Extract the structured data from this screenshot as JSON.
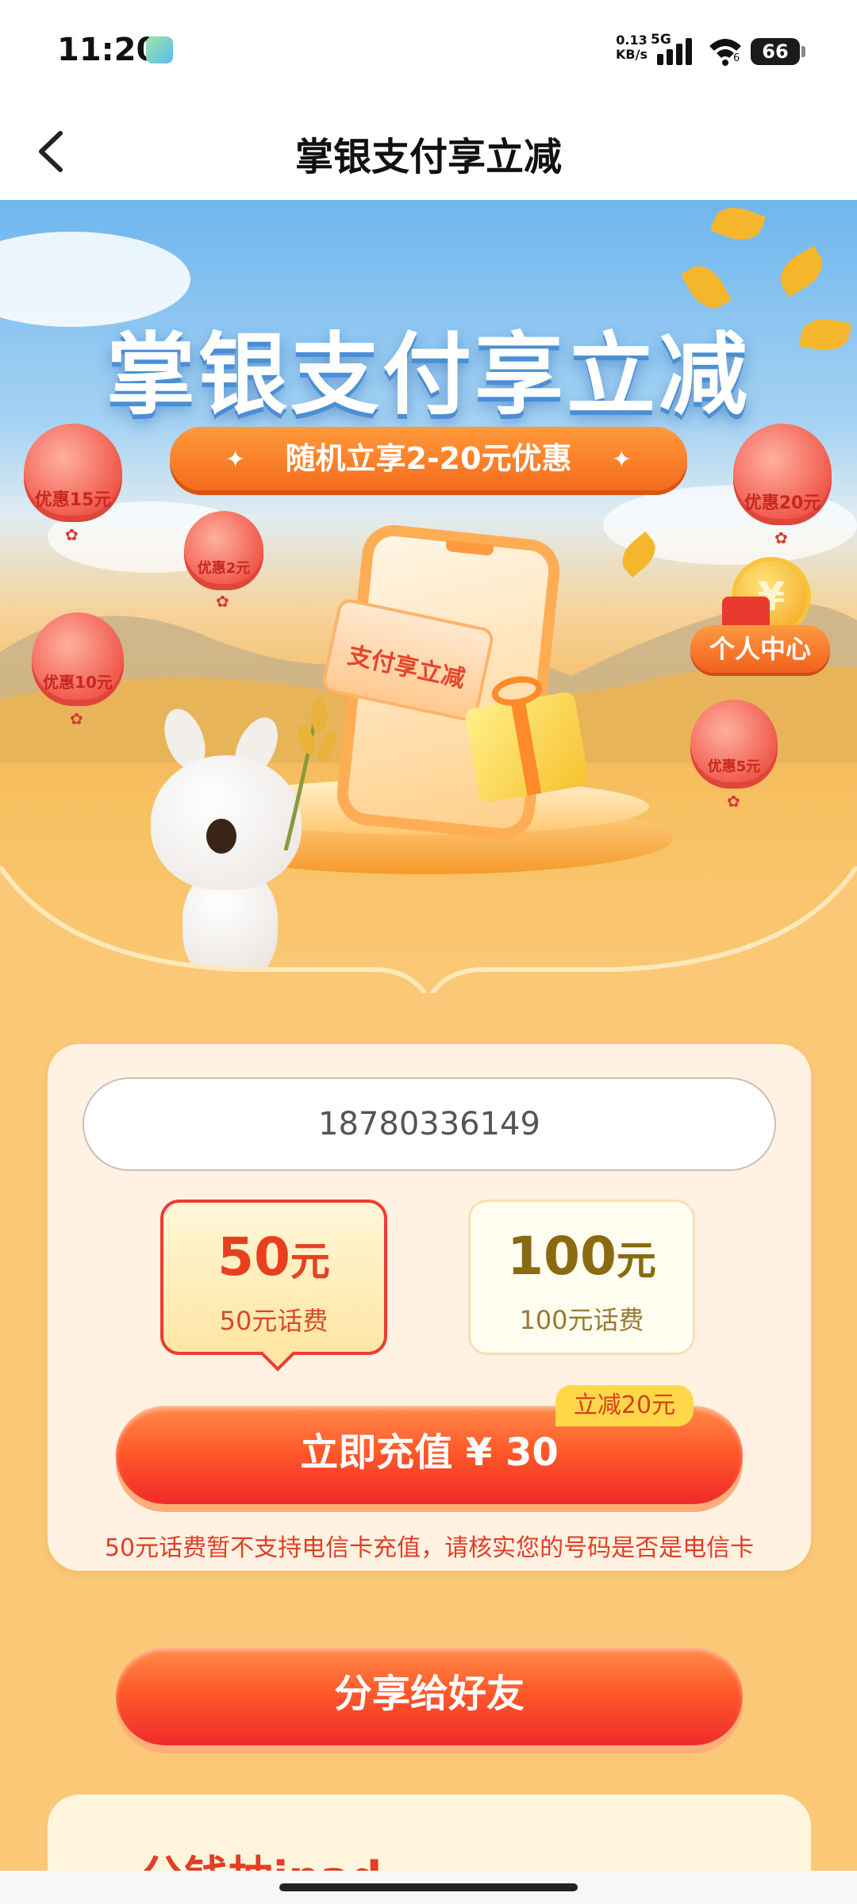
{
  "status_bar": {
    "time": "11:20",
    "net_speed_value": "0.13",
    "net_speed_unit": "KB/s",
    "net_type": "5G",
    "wifi_label": "6",
    "battery_level": "66"
  },
  "nav": {
    "title": "掌银支付享立减",
    "back_icon": "chevron-left-icon"
  },
  "banner": {
    "title": "掌银支付享立减",
    "subtitle": "随机立享2-20元优惠",
    "ticket_text": "支付享立减",
    "personal_center": "个人中心",
    "balloons": [
      {
        "label": "优惠15元"
      },
      {
        "label": "优惠2元"
      },
      {
        "label": "优惠10元"
      },
      {
        "label": "优惠20元"
      },
      {
        "label": "优惠5元"
      }
    ]
  },
  "recharge": {
    "phone_number": "18780336149",
    "options": [
      {
        "amount": "50",
        "unit": "元",
        "desc": "50元话费",
        "selected": true
      },
      {
        "amount": "100",
        "unit": "元",
        "desc": "100元话费",
        "selected": false
      }
    ],
    "button_label": "立即充值 ¥ 30",
    "discount_badge": "立减20元",
    "notice": "50元话费暂不支持电信卡充值，请核实您的号码是否是电信卡"
  },
  "share": {
    "button_label": "分享给好友"
  },
  "promo": {
    "title_partial": "一分钱抽ipad"
  },
  "colors": {
    "accent": "#f5551e",
    "background": "#fbc877",
    "card": "#fff2e2"
  }
}
